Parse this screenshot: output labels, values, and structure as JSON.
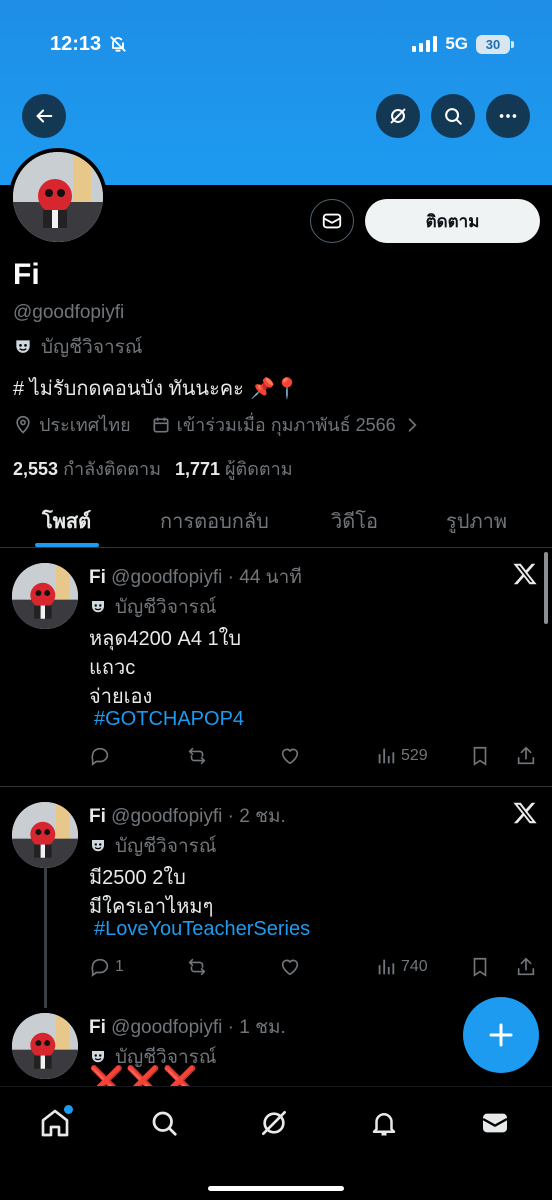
{
  "status_bar": {
    "time": "12:13",
    "network": "5G",
    "battery": "30"
  },
  "profile": {
    "name": "Fi",
    "handle": "@goodfopiyfi",
    "account_type": "บัญชีวิจารณ์",
    "bio": "# ไม่รับกดคอนบัง ทันนะคะ",
    "bio_emoji": "📌📍",
    "location": "ประเทศไทย",
    "joined": "เข้าร่วมเมื่อ กุมภาพันธ์ 2566",
    "following_count": "2,553",
    "following_label": "กำลังติดตาม",
    "followers_count": "1,771",
    "followers_label": "ผู้ติดตาม",
    "follow_label": "ติดตาม"
  },
  "tabs": [
    {
      "label": "โพสต์"
    },
    {
      "label": "การตอบกลับ"
    },
    {
      "label": "วิดีโอ"
    },
    {
      "label": "รูปภาพ"
    }
  ],
  "posts": [
    {
      "name": "Fi",
      "meta": "@goodfopiyfi · 44 นาที",
      "account_type": "บัญชีวิจารณ์",
      "lines": [
        "หลุด4200 A4 1ใบ",
        "แถวc",
        "จ่ายเอง"
      ],
      "hashtag": "#GOTCHAPOP4",
      "replies": "",
      "views": "529"
    },
    {
      "name": "Fi",
      "meta": "@goodfopiyfi · 2 ชม.",
      "account_type": "บัญชีวิจารณ์",
      "lines": [
        "มี2500 2ใบ",
        "มีใครเอาไหมๆ"
      ],
      "hashtag": "#LoveYouTeacherSeries",
      "replies": "1",
      "views": "740"
    },
    {
      "name": "Fi",
      "meta": "@goodfopiyfi · 1 ชม.",
      "account_type": "บัญชีวิจารณ์",
      "marks": "❌❌❌"
    }
  ],
  "colors": {
    "accent": "#1d9bf0",
    "banner": "#1d9bf0",
    "background": "#000000",
    "muted": "#71767b"
  }
}
